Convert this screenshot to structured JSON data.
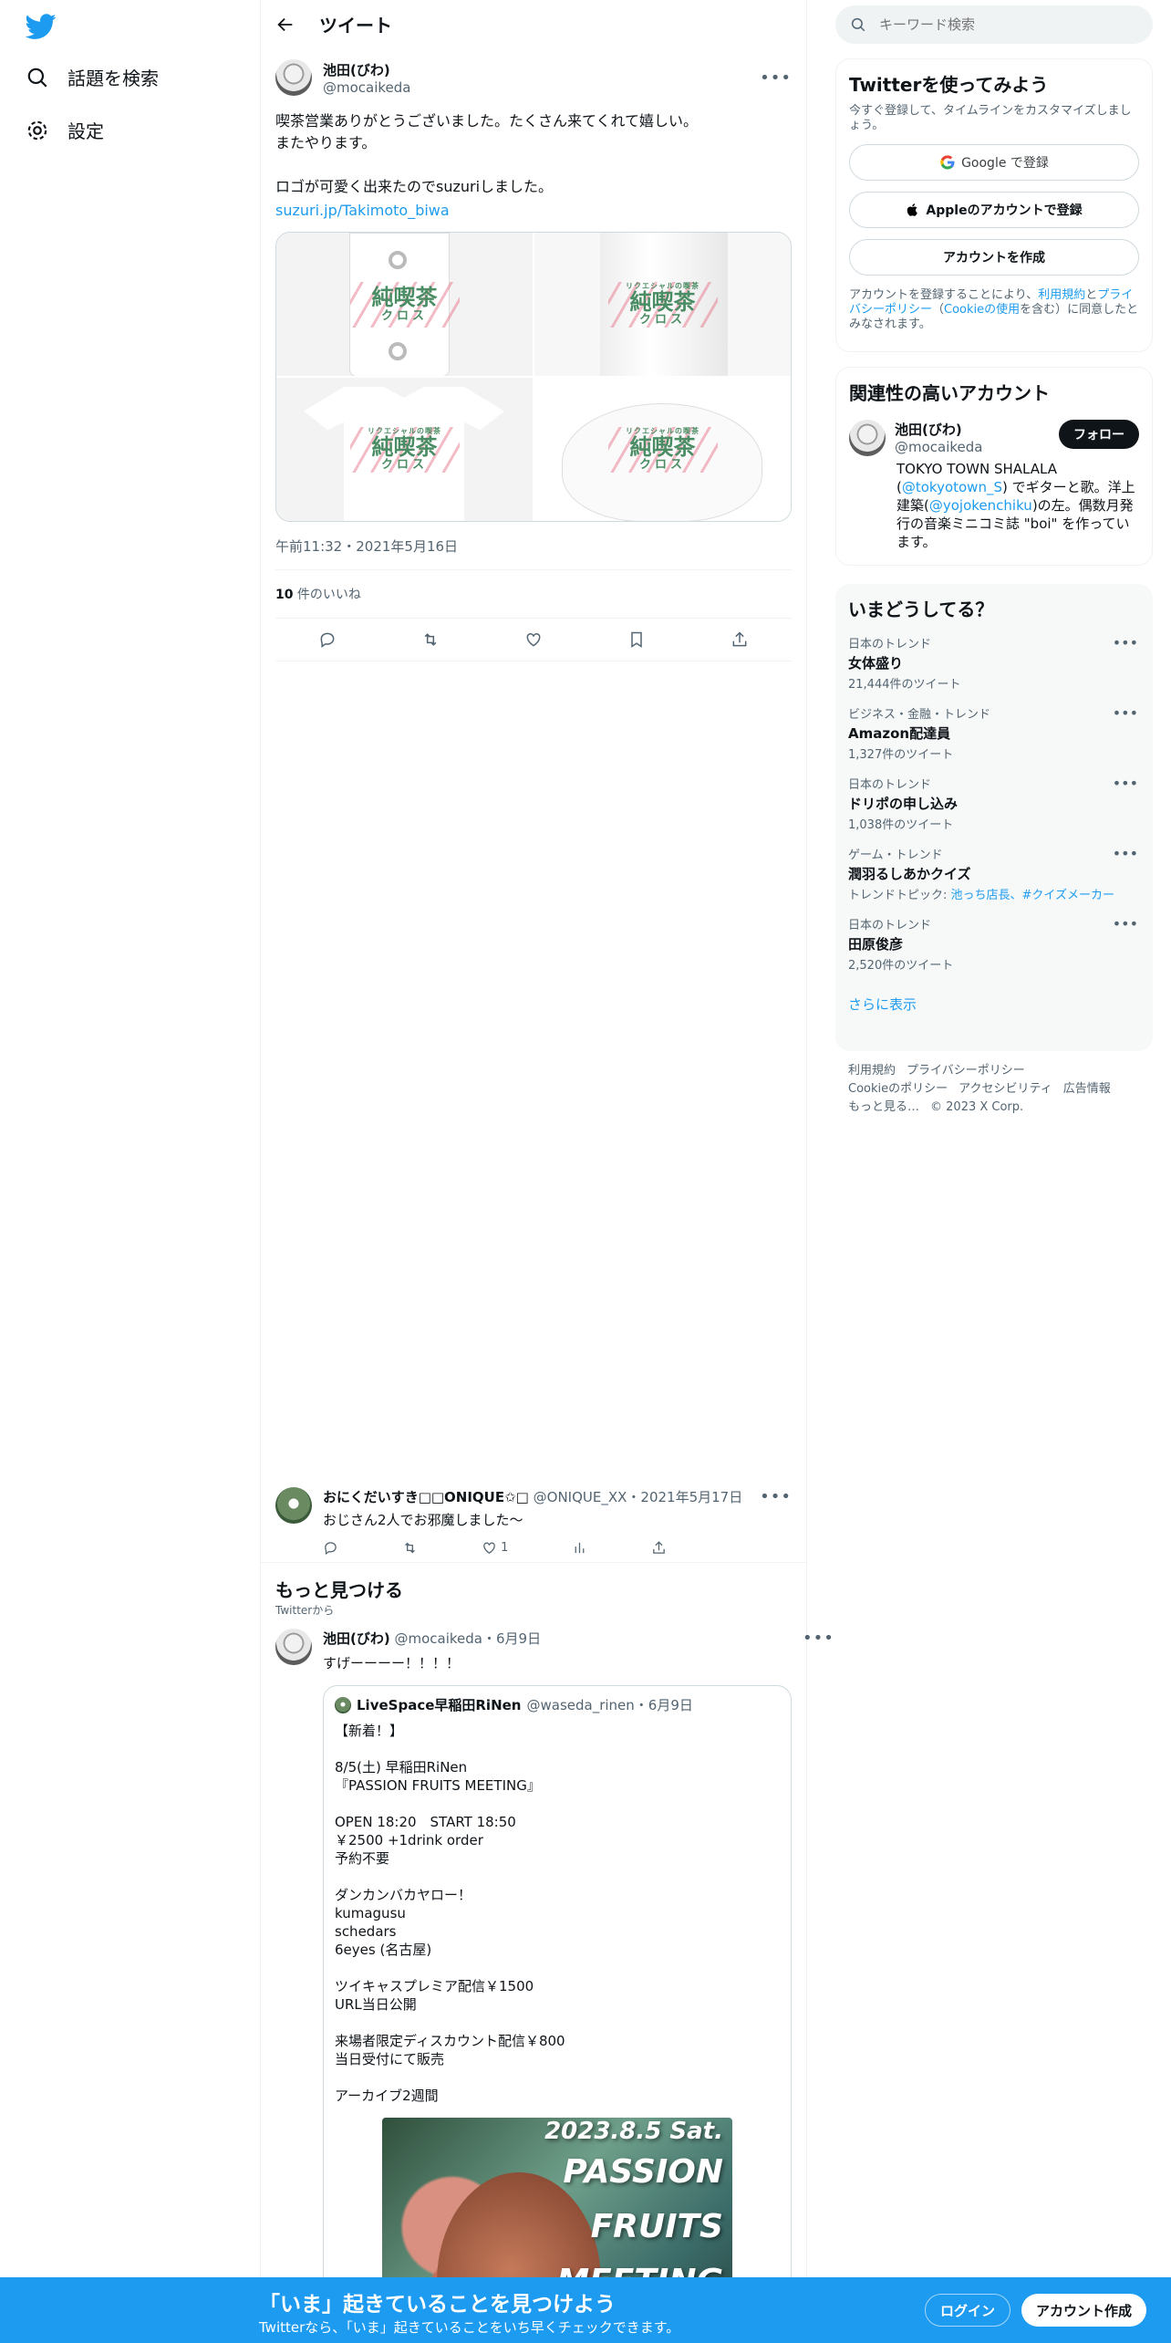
{
  "nav": {
    "explore_label": "話題を検索",
    "settings_label": "設定"
  },
  "header": {
    "title": "ツイート"
  },
  "tweet": {
    "author_name": "池田(びわ)",
    "author_handle": "@mocaikeda",
    "text": "喫茶営業ありがとうございました。たくさん来てくれて嬉しい。\nまたやります。\n\nロゴが可愛く出来たのでsuzuriしました。",
    "link": "suzuri.jp/Takimoto_biwa",
    "product_logo_small": "リクエシャルの喫茶",
    "product_logo_big": "純喫茶",
    "product_logo_sub": "クロス",
    "timestamp": "午前11:32・2021年5月16日",
    "likes_count": "10",
    "likes_label": " 件のいいね"
  },
  "reply": {
    "name": "おにくだいすき□□ONIQUE✩□",
    "handle": "@ONIQUE_XX・2021年5月17日",
    "text": "おじさん2人でお邪魔しました〜",
    "like_count": "1"
  },
  "discover": {
    "title": "もっと見つける",
    "subtitle": "Twitterから"
  },
  "tweet2": {
    "name": "池田(びわ)",
    "handle": "@mocaikeda・6月9日",
    "text": "すげーーーー！！！！",
    "quote_name": "LiveSpace早稲田RiNen",
    "quote_handle": "@waseda_rinen・6月9日",
    "quote_text": "【新着！】\n\n8/5(土) 早稲田RiNen\n『PASSION FRUITS MEETING』\n\nOPEN 18:20　START 18:50\n￥2500 +1drink order\n予約不要\n\nダンカンバカヤロー！\nkumagusu\nschedars\n6eyes (名古屋)\n\nツイキャスプレミア配信￥1500\nURL当日公開\n\n来場者限定ディスカウント配信￥800\n当日受付にて販売\n\nアーカイブ2週間",
    "poster_date": "2023.8.5 Sat.",
    "poster_line1": "PASSION",
    "poster_line2": "FRUITS",
    "poster_line3": "MEETING"
  },
  "search": {
    "placeholder": "キーワード検索"
  },
  "signup_panel": {
    "title": "Twitterを使ってみよう",
    "desc": "今すぐ登録して、タイムラインをカスタマイズしましょう。",
    "google_label": "Google で登録",
    "apple_label": "Appleのアカウントで登録",
    "create_label": "アカウントを作成",
    "legal_pre": "アカウントを登録することにより、",
    "legal_terms": "利用規約",
    "legal_and": "と",
    "legal_privacy": "プライバシーポリシー",
    "legal_open": "（",
    "legal_cookie": "Cookieの使用",
    "legal_post": "を含む）に同意したとみなされます。"
  },
  "related": {
    "title": "関連性の高いアカウント",
    "name": "池田(びわ)",
    "handle": "@mocaikeda",
    "follow_label": "フォロー",
    "bio_1": "TOKYO TOWN SHALALA (",
    "bio_link1": "@tokyotown_S",
    "bio_2": ") でギターと歌。洋上建築(",
    "bio_link2": "@yojokenchiku",
    "bio_3": ")の左。偶数月発行の音楽ミニコミ誌 \"boi\" を作っています。"
  },
  "trends": {
    "title": "いまどうしてる？",
    "items": [
      {
        "meta": "日本のトレンド",
        "name": "女体盛り",
        "count": "21,444件のツイート"
      },
      {
        "meta": "ビジネス・金融・トレンド",
        "name": "Amazon配達員",
        "count": "1,327件のツイート"
      },
      {
        "meta": "日本のトレンド",
        "name": "ドリポの申し込み",
        "count": "1,038件のツイート"
      },
      {
        "meta": "ゲーム・トレンド",
        "name": "潤羽るしあかクイズ",
        "count": "トレンドトピック: ",
        "topics": "池っち店長、#クイズメーカー"
      },
      {
        "meta": "日本のトレンド",
        "name": "田原俊彦",
        "count": "2,520件のツイート"
      }
    ],
    "show_more": "さらに表示"
  },
  "footer": {
    "terms": "利用規約",
    "privacy": "プライバシーポリシー",
    "cookie": "Cookieのポリシー",
    "accessibility": "アクセシビリティ",
    "ads": "広告情報",
    "more": "もっと見る…",
    "copyright": "© 2023 X Corp."
  },
  "banner": {
    "title": "「いま」起きていることを見つけよう",
    "subtitle": "Twitterなら、「いま」起きていることをいち早くチェックできます。",
    "login": "ログイン",
    "signup": "アカウント作成"
  },
  "colors": {
    "accent": "#1d9bf0",
    "text": "#0f1419",
    "muted": "#536471"
  }
}
